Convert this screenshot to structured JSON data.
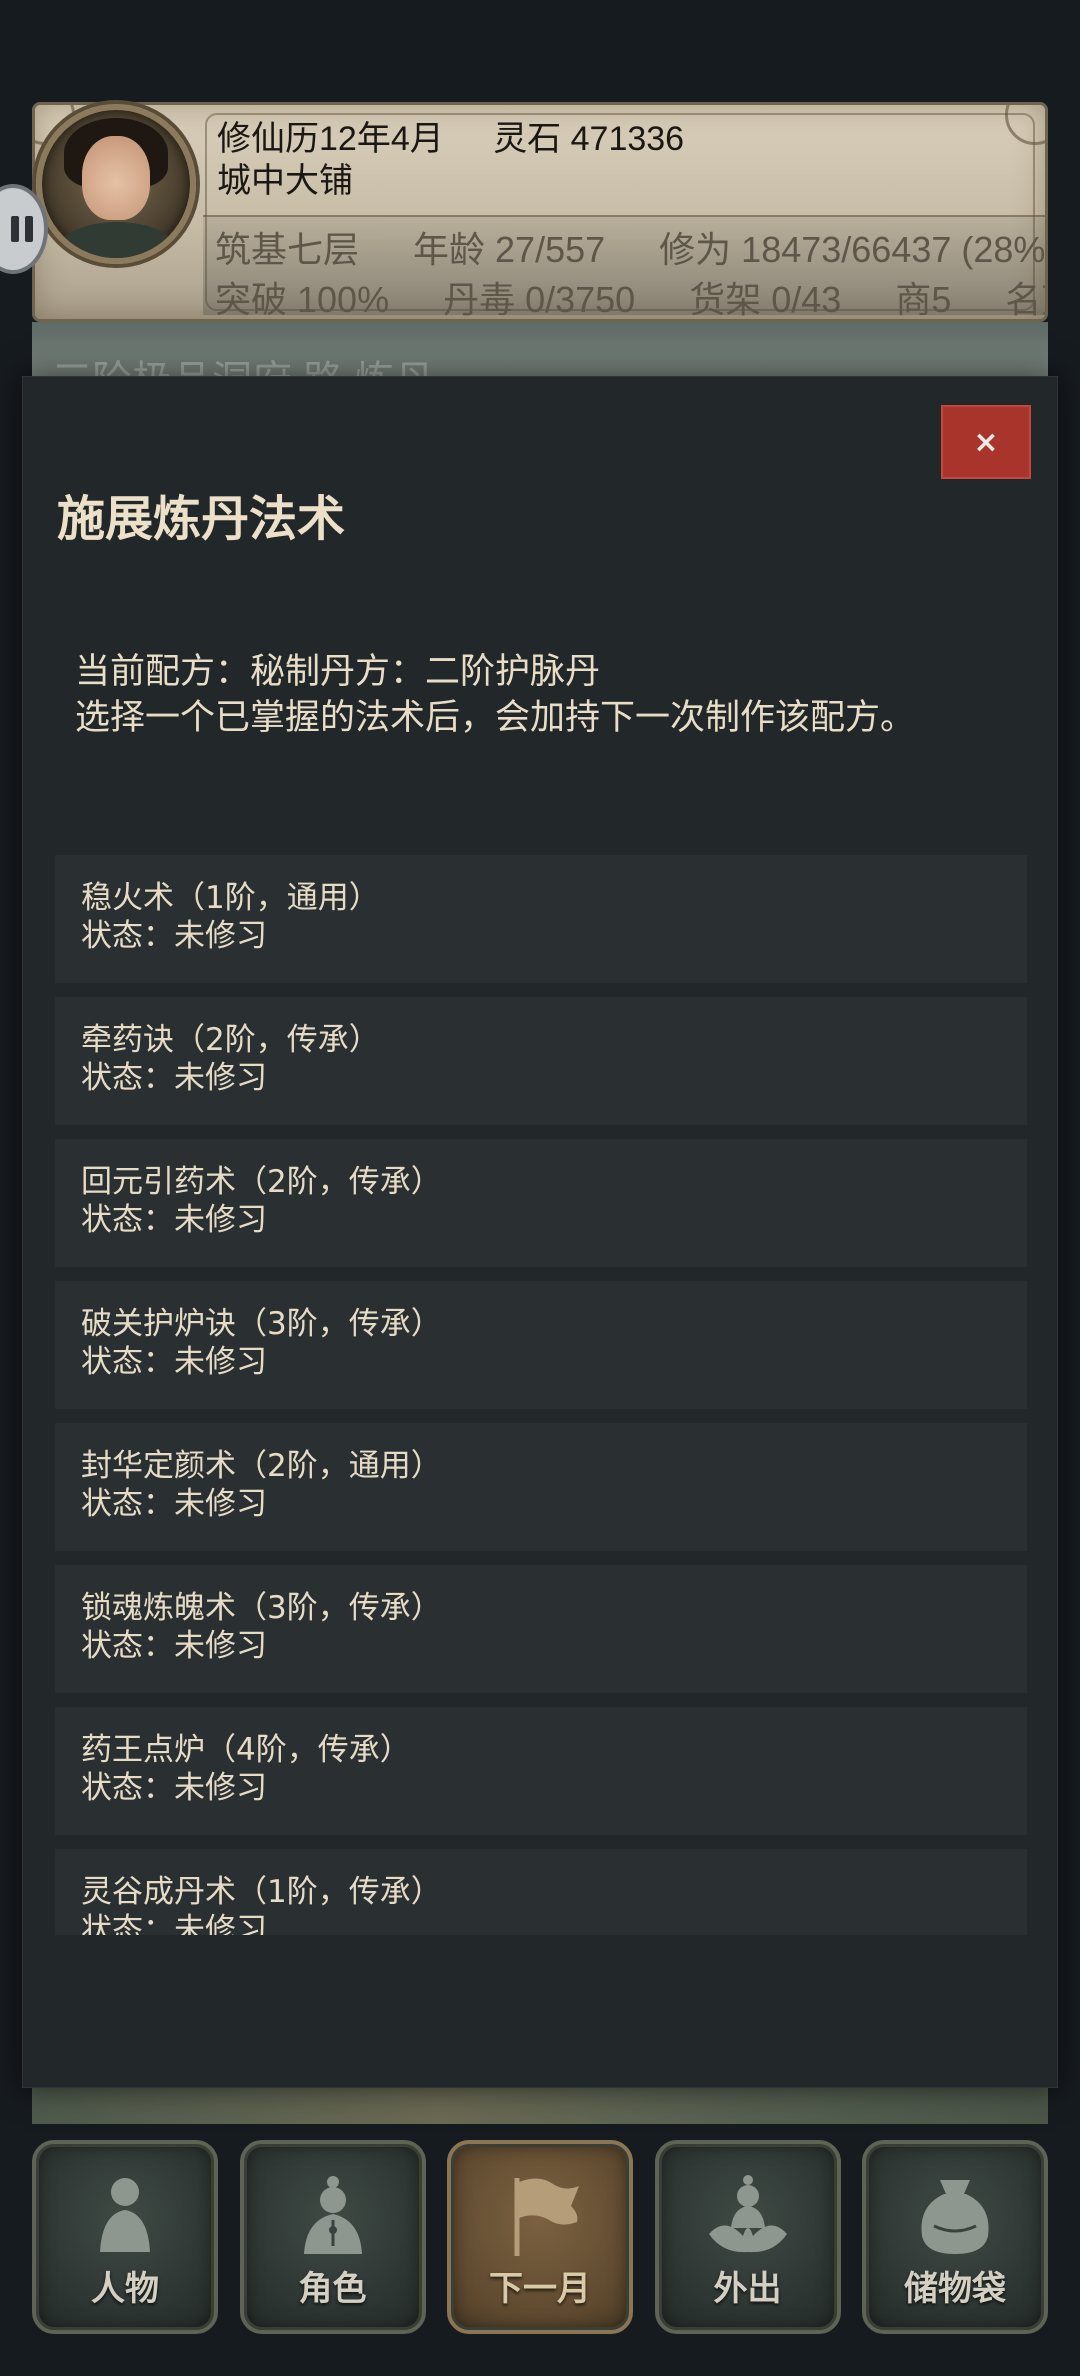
{
  "header": {
    "calendar": "修仙历12年4月",
    "spirit_stones": "灵石 471336",
    "location": "城中大铺",
    "stats_row1": [
      "筑基七层",
      "年龄 27/557",
      "修为 18473/66437 (28%"
    ],
    "stats_row2": [
      "突破 100%",
      "丹毒 0/3750",
      "货架 0/43",
      "商5",
      "名望"
    ]
  },
  "scene": {
    "ghost_title": "三阶极品洞府 路 炼丹"
  },
  "modal": {
    "title": "施展炼丹法术",
    "close_label": "×",
    "recipe_line": "当前配方：秘制丹方：二阶护脉丹",
    "hint_line": "选择一个已掌握的法术后，会加持下一次制作该配方。",
    "spells": [
      {
        "name": "稳火术（1阶，通用）",
        "status": "状态：未修习"
      },
      {
        "name": "牵药诀（2阶，传承）",
        "status": "状态：未修习"
      },
      {
        "name": "回元引药术（2阶，传承）",
        "status": "状态：未修习"
      },
      {
        "name": "破关护炉诀（3阶，传承）",
        "status": "状态：未修习"
      },
      {
        "name": "封华定颜术（2阶，通用）",
        "status": "状态：未修习"
      },
      {
        "name": "锁魂炼魄术（3阶，传承）",
        "status": "状态：未修习"
      },
      {
        "name": "药王点炉（4阶，传承）",
        "status": "状态：未修习"
      },
      {
        "name": "灵谷成丹术（1阶，传承）",
        "status": "状态：未修习"
      }
    ]
  },
  "nav": [
    {
      "label": "人物",
      "icon": "person-icon",
      "active": false
    },
    {
      "label": "角色",
      "icon": "robed-figure-icon",
      "active": false
    },
    {
      "label": "下一月",
      "icon": "flag-icon",
      "active": true
    },
    {
      "label": "外出",
      "icon": "lotus-figure-icon",
      "active": false
    },
    {
      "label": "储物袋",
      "icon": "bag-icon",
      "active": false
    }
  ],
  "colors": {
    "background": "#161b1f",
    "modal": "#222729",
    "list_item": "#2a2f32",
    "close_button": "#a9342b",
    "text_primary": "#e6dcc6"
  }
}
